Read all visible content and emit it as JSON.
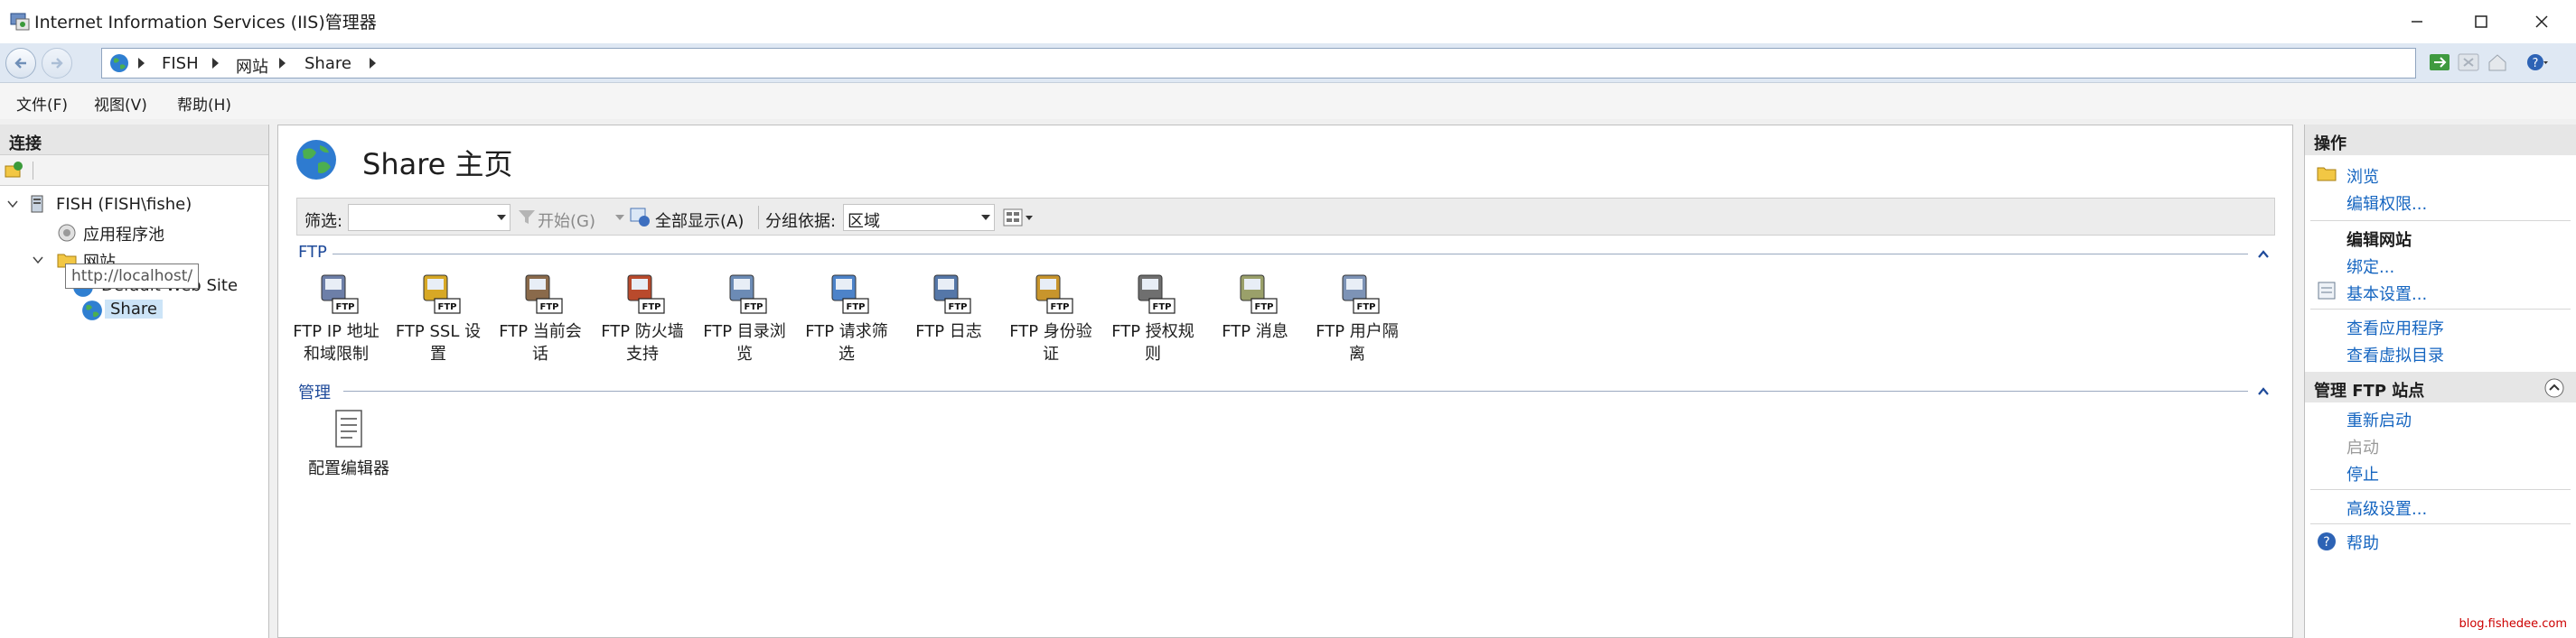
{
  "window": {
    "title": "Internet Information Services (IIS)管理器"
  },
  "address": {
    "crumbs": [
      "FISH",
      "网站",
      "Share"
    ]
  },
  "menu": {
    "file": "文件(F)",
    "view": "视图(V)",
    "help": "帮助(H)"
  },
  "connections": {
    "header": "连接",
    "server": "FISH (FISH\\fishe)",
    "app_pools": "应用程序池",
    "sites": "网站",
    "default_site": "Default Web Site",
    "share": "Share",
    "tooltip": "http://localhost/"
  },
  "content": {
    "title": "Share 主页",
    "filter_label": "筛选:",
    "filter_value": "",
    "start": "开始(G)",
    "show_all": "全部显示(A)",
    "group_by_label": "分组依据:",
    "group_by_value": "区域",
    "sections": {
      "ftp": {
        "label": "FTP",
        "items": [
          {
            "line1": "FTP IP 地址",
            "line2": "和域限制"
          },
          {
            "line1": "FTP SSL 设",
            "line2": "置"
          },
          {
            "line1": "FTP 当前会",
            "line2": "话"
          },
          {
            "line1": "FTP 防火墙",
            "line2": "支持"
          },
          {
            "line1": "FTP 目录浏",
            "line2": "览"
          },
          {
            "line1": "FTP 请求筛",
            "line2": "选"
          },
          {
            "line1": "FTP 日志",
            "line2": ""
          },
          {
            "line1": "FTP 身份验",
            "line2": "证"
          },
          {
            "line1": "FTP 授权规",
            "line2": "则"
          },
          {
            "line1": "FTP 消息",
            "line2": ""
          },
          {
            "line1": "FTP 用户隔",
            "line2": "离"
          }
        ]
      },
      "manage": {
        "label": "管理",
        "items": [
          {
            "line1": "配置编辑器",
            "line2": ""
          }
        ]
      }
    }
  },
  "actions": {
    "header": "操作",
    "browse": "浏览",
    "edit_permissions": "编辑权限...",
    "edit_site_title": "编辑网站",
    "bindings": "绑定...",
    "basic_settings": "基本设置...",
    "view_apps": "查看应用程序",
    "view_vdirs": "查看虚拟目录",
    "manage_ftp_title": "管理 FTP 站点",
    "restart": "重新启动",
    "start": "启动",
    "stop": "停止",
    "advanced_settings": "高级设置...",
    "help": "帮助"
  },
  "watermark": "blog.fishedee.com",
  "colors": {
    "link": "#1565c0",
    "section": "#1e4a9a",
    "address_bg": "#dfe8f3"
  }
}
